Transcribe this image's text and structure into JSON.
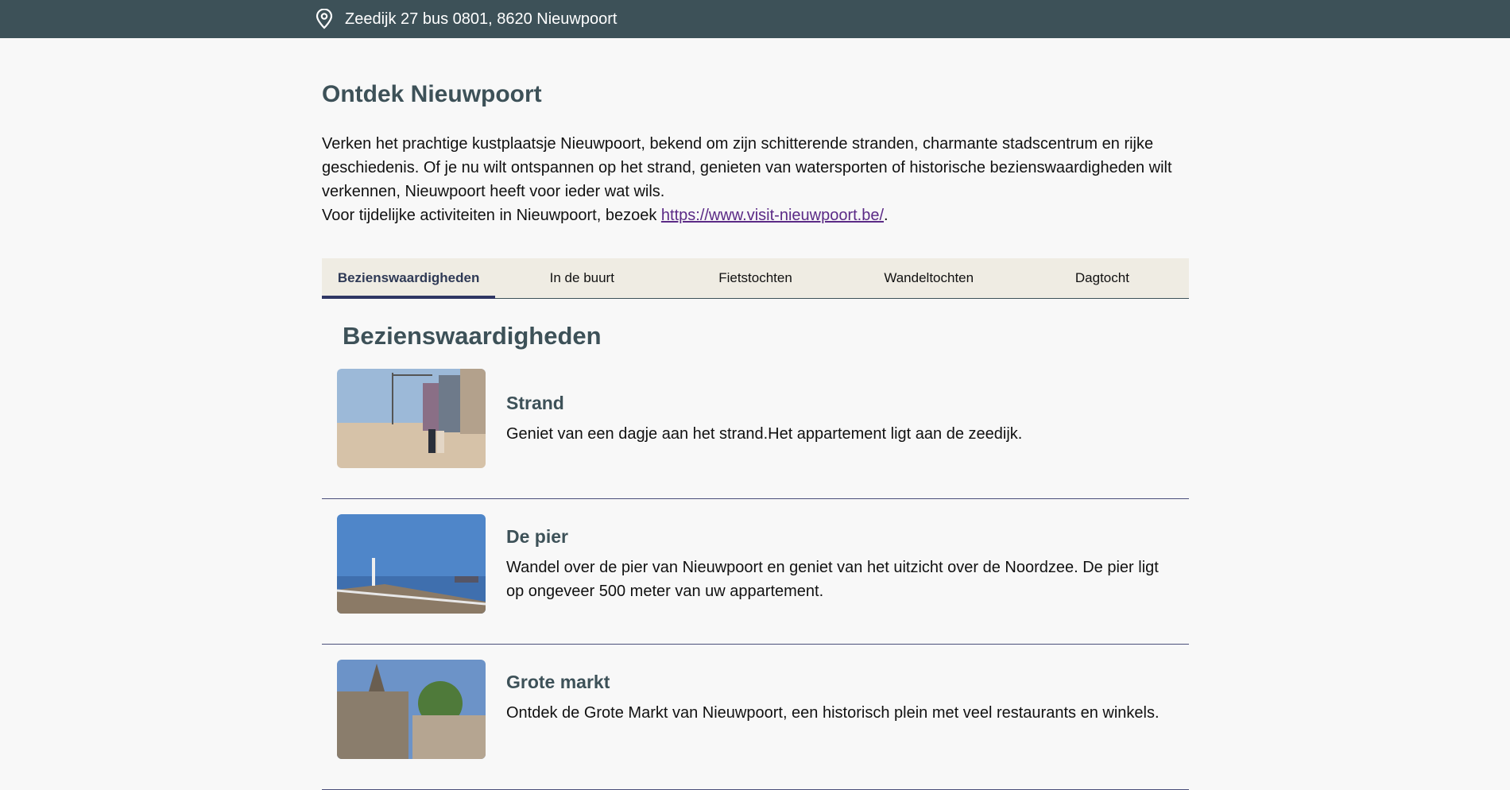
{
  "topbar": {
    "address": "Zeedijk 27 bus 0801, 8620 Nieuwpoort",
    "icon": "location-pin-icon"
  },
  "main": {
    "title": "Ontdek Nieuwpoort",
    "intro_line1": "Verken het prachtige kustplaatsje Nieuwpoort, bekend om zijn schitterende stranden, charmante stadscentrum en rijke geschiedenis. Of je nu wilt ontspannen op het strand, genieten van watersporten of historische bezienswaardigheden wilt verkennen, Nieuwpoort heeft voor ieder wat wils.",
    "intro_line2_prefix": "Voor tijdelijke activiteiten in Nieuwpoort, bezoek ",
    "intro_link": "https://www.visit-nieuwpoort.be/",
    "intro_line2_suffix": "."
  },
  "tabs": [
    {
      "label": "Bezienswaardigheden",
      "active": true
    },
    {
      "label": "In de buurt",
      "active": false
    },
    {
      "label": "Fietstochten",
      "active": false
    },
    {
      "label": "Wandeltochten",
      "active": false
    },
    {
      "label": "Dagtocht",
      "active": false
    }
  ],
  "section": {
    "title": "Bezienswaardigheden",
    "items": [
      {
        "title": "Strand",
        "description": "Geniet van een dagje aan het strand.Het appartement ligt aan de zeedijk."
      },
      {
        "title": "De pier",
        "description": "Wandel over de pier van Nieuwpoort en geniet van het uitzicht over de Noordzee. De pier ligt op ongeveer 500 meter van uw appartement."
      },
      {
        "title": "Grote markt",
        "description": "Ontdek de Grote Markt van Nieuwpoort, een historisch plein met veel restaurants en winkels."
      }
    ]
  },
  "colors": {
    "topbar": "#3d5158",
    "heading": "#3d5158",
    "tabs_bg": "#efece3",
    "active_tab_indicator": "#2f3663",
    "link": "#5b2a86"
  }
}
